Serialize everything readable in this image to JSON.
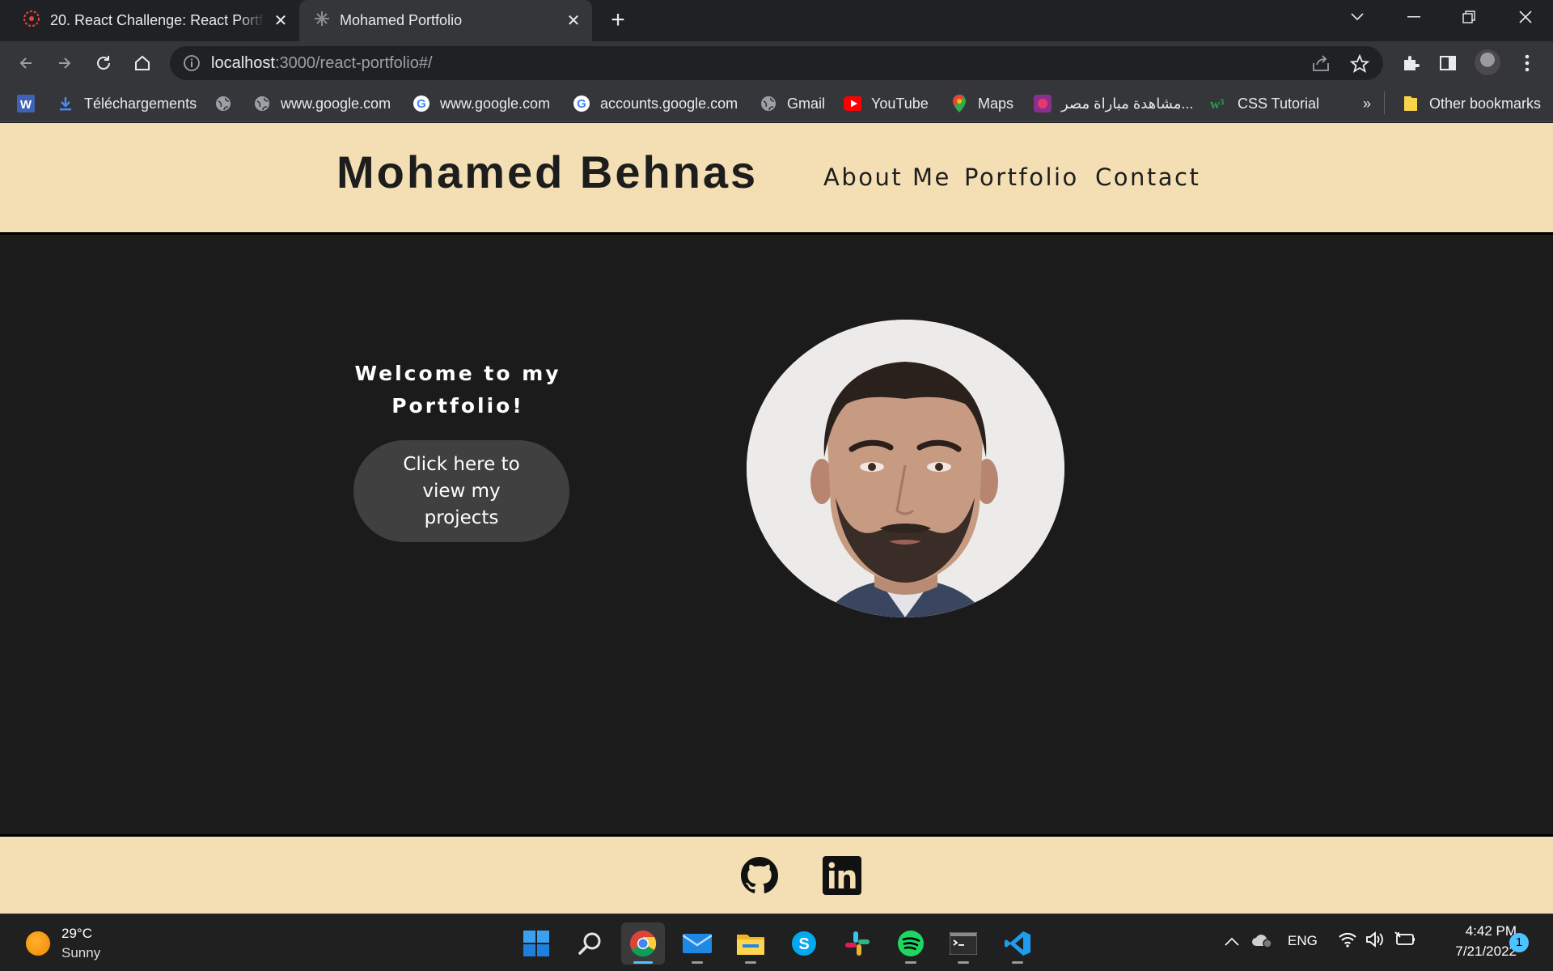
{
  "browser": {
    "tabs": [
      {
        "title": "20. React Challenge: React Portfolio",
        "active": false
      },
      {
        "title": "Mohamed Portfolio",
        "active": true
      }
    ],
    "url_host": "localhost",
    "url_rest": ":3000/react-portfolio#/",
    "bookmarks": [
      {
        "label": "",
        "icon": "word-icon"
      },
      {
        "label": "Téléchargements",
        "icon": "download-icon"
      },
      {
        "label": "",
        "icon": "globe-icon"
      },
      {
        "label": "www.google.com",
        "icon": "globe-icon"
      },
      {
        "label": "www.google.com",
        "icon": "google-icon"
      },
      {
        "label": "accounts.google.com",
        "icon": "google-icon"
      },
      {
        "label": "Gmail",
        "icon": "globe-icon"
      },
      {
        "label": "YouTube",
        "icon": "youtube-icon"
      },
      {
        "label": "Maps",
        "icon": "maps-icon"
      },
      {
        "label": "مشاهدة مباراة مصر...",
        "icon": "site-icon"
      },
      {
        "label": "CSS Tutorial",
        "icon": "w3schools-icon"
      }
    ],
    "more_bookmarks": "»",
    "other_bookmarks": "Other bookmarks"
  },
  "site": {
    "brand": "Mohamed Behnas",
    "nav": [
      "About Me",
      "Portfolio",
      "Contact"
    ],
    "welcome": "Welcome to my Portfolio!",
    "cta": "Click here to view my projects",
    "social": [
      "github-icon",
      "linkedin-icon"
    ]
  },
  "taskbar": {
    "temperature": "29°C",
    "condition": "Sunny",
    "language": "ENG",
    "time": "4:42 PM",
    "date": "7/21/2022",
    "notifications": "1"
  },
  "colors": {
    "header_bg": "#f3dfb3",
    "page_bg": "#1b1b1c",
    "button_bg": "#404040"
  }
}
